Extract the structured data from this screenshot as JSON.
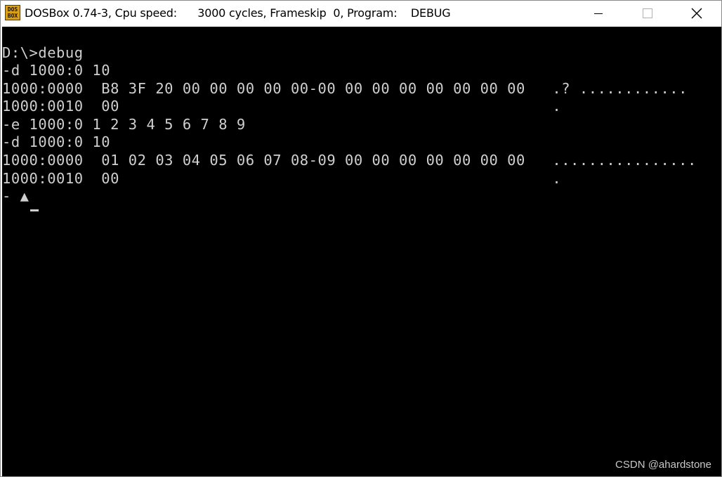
{
  "window": {
    "title": "DOSBox 0.74-3, Cpu speed:      3000 cycles, Frameskip  0, Program:    DEBUG",
    "icon_text_top": "DOS",
    "icon_text_bottom": "BOX",
    "icon_name": "dosbox-app-icon",
    "buttons": {
      "minimize_icon": "minimize-icon",
      "maximize_icon": "maximize-icon",
      "close_icon": "close-icon"
    }
  },
  "terminal": {
    "lines": [
      "D:\\>debug",
      "-d 1000:0 10",
      "1000:0000  B8 3F 20 00 00 00 00 00-00 00 00 00 00 00 00 00   .? ............",
      "1000:0010  00                                                .",
      "-e 1000:0 1 2 3 4 5 6 7 8 9",
      "-d 1000:0 10",
      "1000:0000  01 02 03 04 05 06 07 08-09 00 00 00 00 00 00 00   ................",
      "1000:0010  00                                                .",
      "- ▲"
    ],
    "colors": {
      "background": "#000000",
      "foreground": "#cfcfcf"
    }
  },
  "watermark": "CSDN @ahardstone"
}
